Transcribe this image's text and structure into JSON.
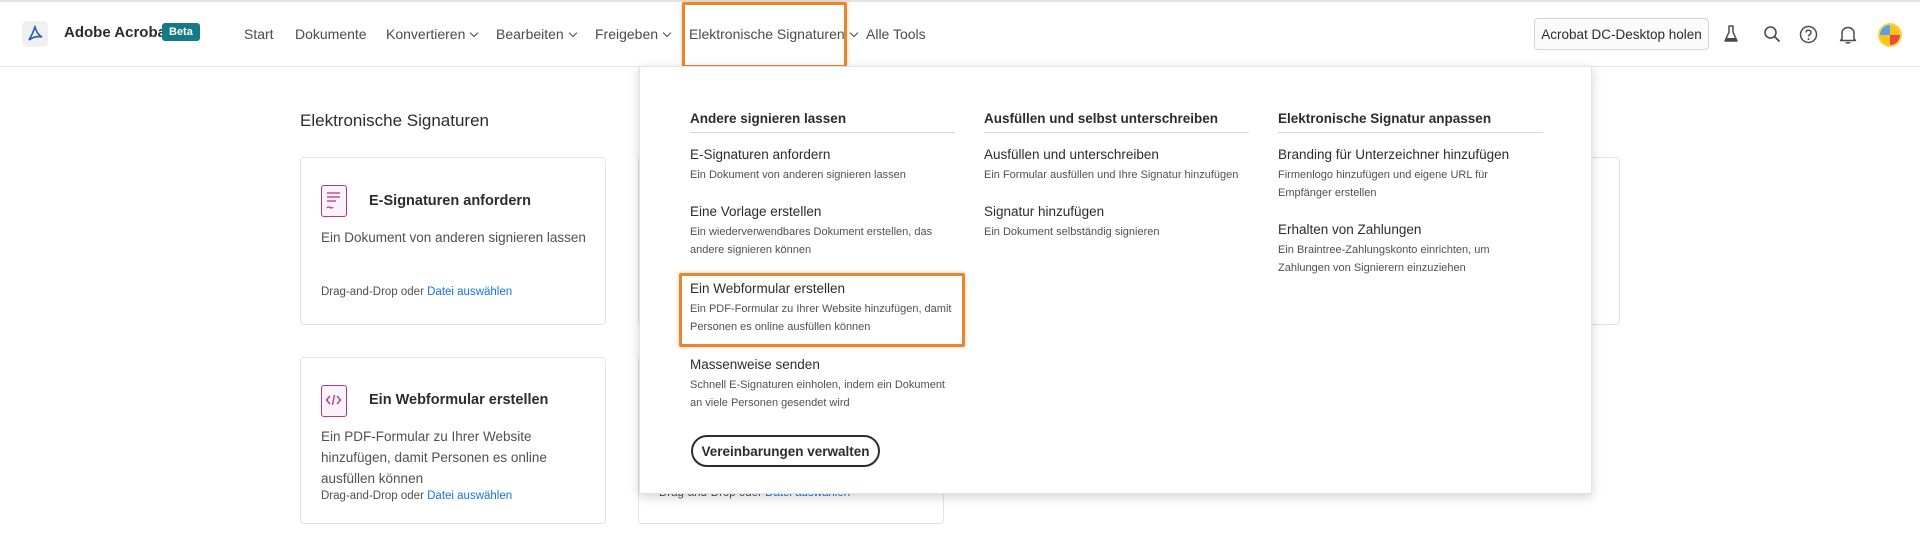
{
  "header": {
    "app_name": "Adobe Acrobat",
    "beta_badge": "Beta",
    "nav": {
      "start": "Start",
      "dokumente": "Dokumente",
      "konvertieren": "Konvertieren",
      "bearbeiten": "Bearbeiten",
      "freigeben": "Freigeben",
      "esign": "Elektronische Signaturen",
      "alle_tools": "Alle Tools"
    },
    "desktop_button": "Acrobat DC-Desktop holen",
    "icons": [
      "flask-icon",
      "search-icon",
      "help-icon",
      "bell-icon",
      "avatar"
    ]
  },
  "main": {
    "section_title": "Elektronische Signaturen",
    "card1": {
      "title": "E-Signaturen anfordern",
      "desc": "Ein Dokument von anderen signieren lassen",
      "foot_prefix": "Drag-and-Drop oder",
      "foot_link": "Datei auswählen"
    },
    "card2": {
      "title": "Ein Webformular erstellen",
      "desc": "Ein PDF-Formular zu Ihrer Website hinzufügen, damit Personen es online ausfüllen können",
      "foot_prefix": "Drag-and-Drop oder",
      "foot_link": "Datei auswählen"
    },
    "card4_foot_prefix": "Drag-and-Drop oder",
    "card4_foot_link": "Datei auswählen"
  },
  "dropdown": {
    "col1": {
      "heading": "Andere signieren lassen",
      "items": [
        {
          "title": "E-Signaturen anfordern",
          "desc": "Ein Dokument von anderen signieren lassen"
        },
        {
          "title": "Eine Vorlage erstellen",
          "desc": "Ein wiederverwendbares Dokument erstellen, das andere signieren können"
        },
        {
          "title": "Ein Webformular erstellen",
          "desc": "Ein PDF-Formular zu Ihrer Website hinzufügen, damit Personen es online ausfüllen können"
        },
        {
          "title": "Massenweise senden",
          "desc": "Schnell E-Signaturen einholen, indem ein Dokument an viele Personen gesendet wird"
        }
      ],
      "button": "Vereinbarungen verwalten"
    },
    "col2": {
      "heading": "Ausfüllen und selbst unterschreiben",
      "items": [
        {
          "title": "Ausfüllen und unterschreiben",
          "desc": "Ein Formular ausfüllen und Ihre Signatur hinzufügen"
        },
        {
          "title": "Signatur hinzufügen",
          "desc": "Ein Dokument selbständig signieren"
        }
      ]
    },
    "col3": {
      "heading": "Elektronische Signatur anpassen",
      "items": [
        {
          "title": "Branding für Unterzeichner hinzufügen",
          "desc": "Firmenlogo hinzufügen und eigene URL für Empfänger erstellen"
        },
        {
          "title": "Erhalten von Zahlungen",
          "desc": "Ein Braintree-Zahlungskonto einrichten, um Zahlungen von Signierern einzuziehen"
        }
      ]
    }
  },
  "colors": {
    "highlight": "#e8862e",
    "beta_bg": "#147a85",
    "link": "#1473e6",
    "card_icon": "#b4378f"
  }
}
